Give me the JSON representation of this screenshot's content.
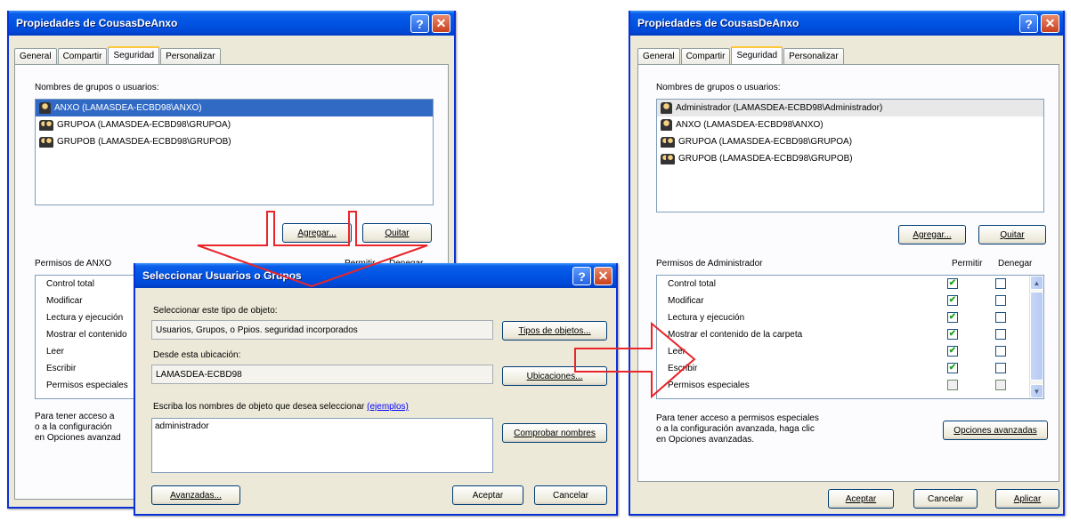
{
  "left_window": {
    "title": "Propiedades de CousasDeAnxo",
    "help_glyph": "?",
    "close_glyph": "✕",
    "tabs": [
      "General",
      "Compartir",
      "Seguridad",
      "Personalizar"
    ],
    "users_label": "Nombres de grupos o usuarios:",
    "users": [
      {
        "name": "ANXO (LAMASDEA-ECBD98\\ANXO)",
        "icon": "user-icon",
        "selected": true
      },
      {
        "name": "GRUPOA (LAMASDEA-ECBD98\\GRUPOA)",
        "icon": "group-icon",
        "selected": false
      },
      {
        "name": "GRUPOB (LAMASDEA-ECBD98\\GRUPOB)",
        "icon": "group-icon",
        "selected": false
      }
    ],
    "add_label": "Agregar...",
    "remove_label": "Quitar",
    "perms_label": "Permisos de ANXO",
    "permit_header": "Permitir",
    "deny_header": "Denegar",
    "perms": [
      "Control total",
      "Modificar",
      "Lectura y ejecución",
      "Mostrar el contenido",
      "Leer",
      "Escribir",
      "Permisos especiales"
    ],
    "info": [
      "Para tener acceso a",
      "o a la configuración",
      "en Opciones avanzad"
    ]
  },
  "dialog": {
    "title": "Seleccionar Usuarios o Grupos",
    "help_glyph": "?",
    "close_glyph": "✕",
    "type_label": "Seleccionar este tipo de objeto:",
    "type_value": "Usuarios, Grupos, o Ppios. seguridad incorporados",
    "types_button": "Tipos de objetos...",
    "location_label": "Desde esta ubicación:",
    "location_value": "LAMASDEA-ECBD98",
    "locations_button": "Ubicaciones...",
    "names_label": "Escriba los nombres de objeto que desea seleccionar",
    "examples_link": "(ejemplos)",
    "names_value": "administrador",
    "check_button": "Comprobar nombres",
    "advanced_button": "Avanzadas...",
    "ok_button": "Aceptar",
    "cancel_button": "Cancelar"
  },
  "right_window": {
    "title": "Propiedades de CousasDeAnxo",
    "help_glyph": "?",
    "close_glyph": "✕",
    "tabs": [
      "General",
      "Compartir",
      "Seguridad",
      "Personalizar"
    ],
    "users_label": "Nombres de grupos o usuarios:",
    "users": [
      {
        "name": "Administrador (LAMASDEA-ECBD98\\Administrador)",
        "icon": "user-icon",
        "selected": true
      },
      {
        "name": "ANXO (LAMASDEA-ECBD98\\ANXO)",
        "icon": "user-icon",
        "selected": false
      },
      {
        "name": "GRUPOA (LAMASDEA-ECBD98\\GRUPOA)",
        "icon": "group-icon",
        "selected": false
      },
      {
        "name": "GRUPOB (LAMASDEA-ECBD98\\GRUPOB)",
        "icon": "group-icon",
        "selected": false
      }
    ],
    "add_label": "Agregar...",
    "remove_label": "Quitar",
    "perms_label": "Permisos de Administrador",
    "permit_header": "Permitir",
    "deny_header": "Denegar",
    "perms": [
      {
        "name": "Control total",
        "permit": true,
        "deny": false
      },
      {
        "name": "Modificar",
        "permit": true,
        "deny": false
      },
      {
        "name": "Lectura y ejecución",
        "permit": true,
        "deny": false
      },
      {
        "name": "Mostrar el contenido de la carpeta",
        "permit": true,
        "deny": false
      },
      {
        "name": "Leer",
        "permit": true,
        "deny": false
      },
      {
        "name": "Escribir",
        "permit": true,
        "deny": false
      },
      {
        "name": "Permisos especiales",
        "permit": false,
        "deny": false
      }
    ],
    "info": [
      "Para tener acceso a permisos especiales",
      "o a la configuración avanzada, haga clic",
      "en Opciones avanzadas."
    ],
    "advanced_button": "Opciones avanzadas",
    "ok_button": "Aceptar",
    "cancel_button": "Cancelar",
    "apply_button": "Aplicar",
    "check_glyph": "✔"
  },
  "colors": {
    "arrow": "#e8252a",
    "title_blue": "#0054e3",
    "selection": "#316ac5"
  }
}
